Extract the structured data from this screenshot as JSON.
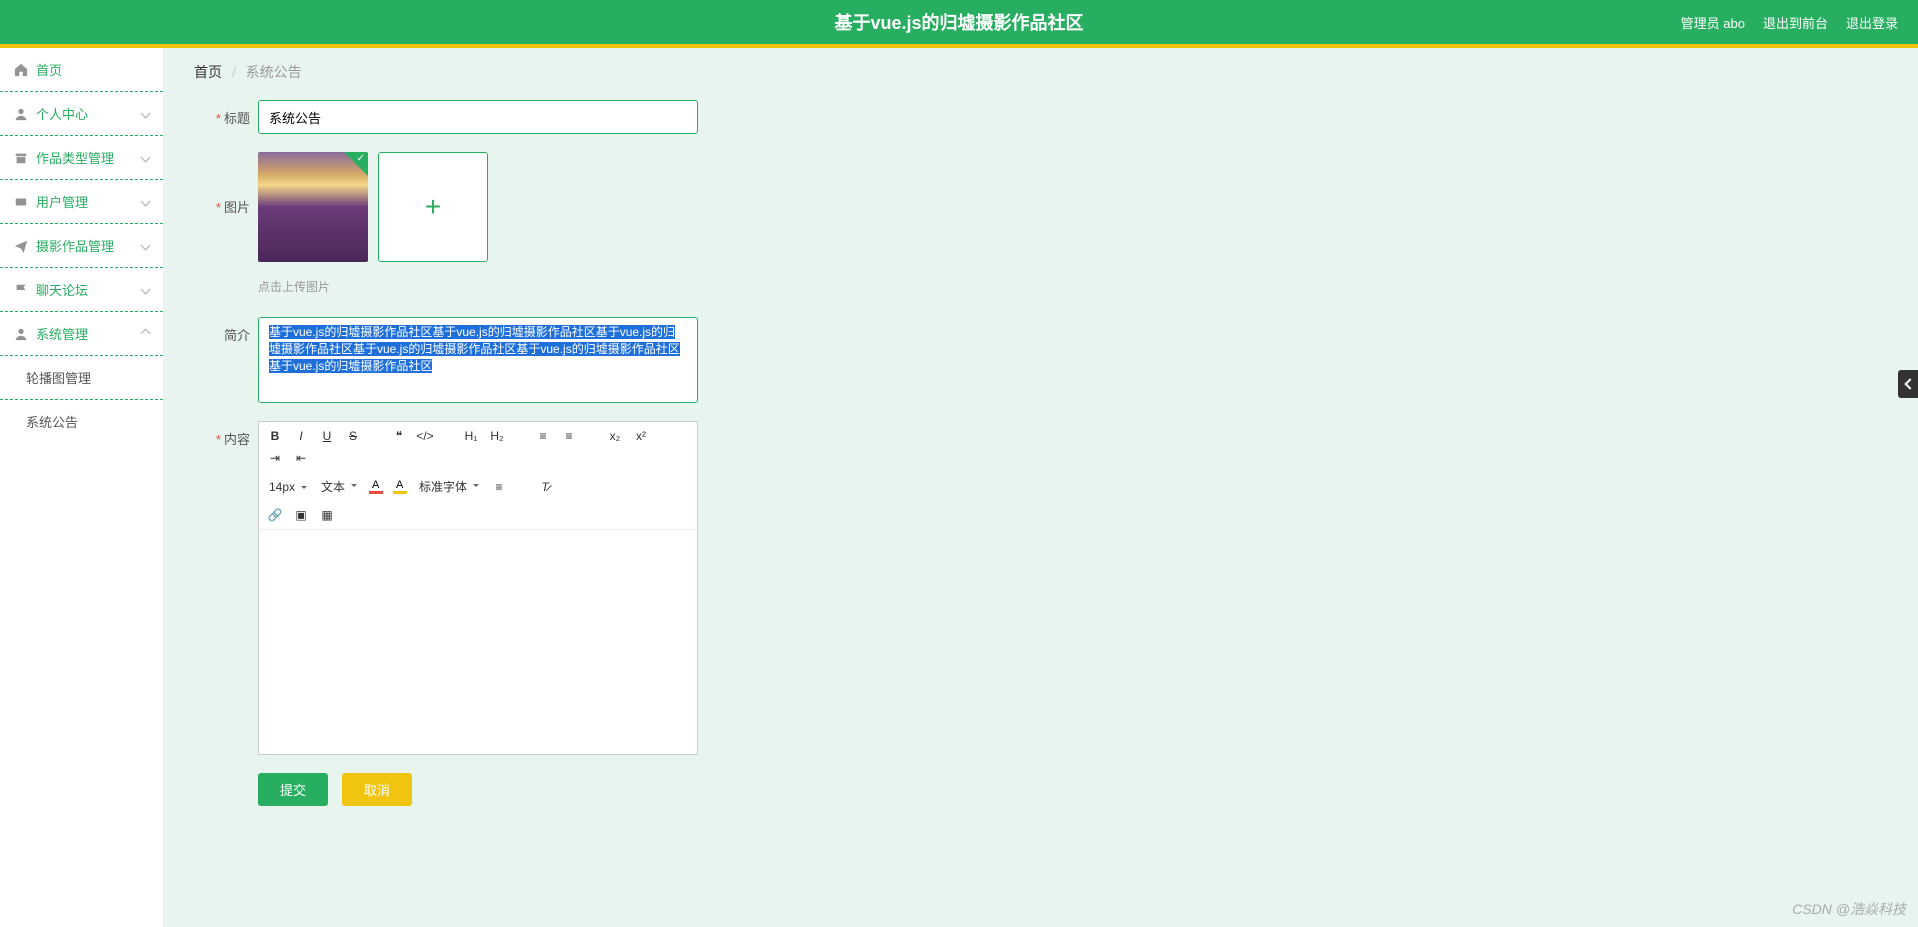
{
  "header": {
    "title": "基于vue.js的归墟摄影作品社区",
    "admin_label": "管理员 abo",
    "exit_front": "退出到前台",
    "logout": "退出登录"
  },
  "sidebar": {
    "items": [
      {
        "label": "首页",
        "icon": "home"
      },
      {
        "label": "个人中心",
        "icon": "user"
      },
      {
        "label": "作品类型管理",
        "icon": "archive"
      },
      {
        "label": "用户管理",
        "icon": "users"
      },
      {
        "label": "摄影作品管理",
        "icon": "send"
      },
      {
        "label": "聊天论坛",
        "icon": "flag"
      },
      {
        "label": "系统管理",
        "icon": "user"
      }
    ],
    "sub_items": [
      {
        "label": "轮播图管理"
      },
      {
        "label": "系统公告"
      }
    ]
  },
  "breadcrumb": {
    "home": "首页",
    "current": "系统公告"
  },
  "form": {
    "title_label": "标题",
    "title_value": "系统公告",
    "image_label": "图片",
    "upload_hint": "点击上传图片",
    "intro_label": "简介",
    "intro_value": "基于vue.js的归墟摄影作品社区基于vue.js的归墟摄影作品社区基于vue.js的归墟摄影作品社区基于vue.js的归墟摄影作品社区基于vue.js的归墟摄影作品社区基于vue.js的归墟摄影作品社区",
    "content_label": "内容"
  },
  "editor": {
    "font_size": "14px",
    "font_style": "文本",
    "font_family": "标准字体"
  },
  "buttons": {
    "submit": "提交",
    "cancel": "取消"
  },
  "watermark": "CSDN @浩焱科技"
}
